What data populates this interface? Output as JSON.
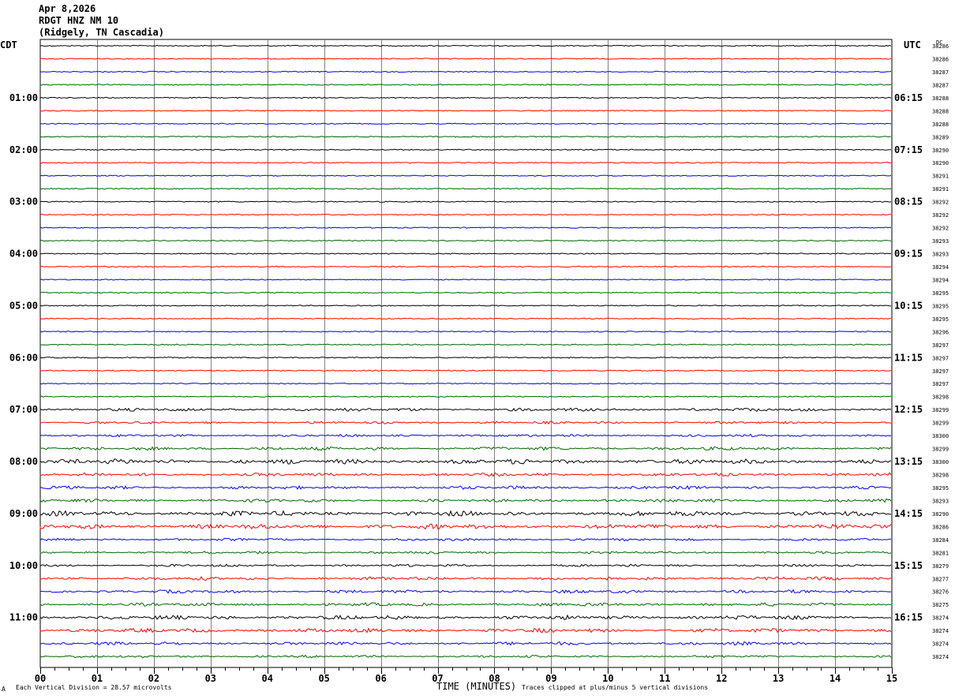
{
  "header": {
    "date": "Apr 8,2026",
    "station": "RDGT HNZ NM 10",
    "location": "(Ridgely, TN Cascadia)"
  },
  "left_tz": "CDT",
  "right_tz": "UTC",
  "dc_label": "DC",
  "footer": {
    "scale_note": "Each Vertical Division =   28.57 microvolts",
    "clip_note": "Traces clipped at plus/minus 5 vertical divisions",
    "corner_mark": "A"
  },
  "colors": {
    "trace_cycle": [
      "#000000",
      "#ff0000",
      "#0000ff",
      "#006400"
    ],
    "grid": "#808080"
  },
  "chart_data": {
    "type": "line",
    "title": "",
    "xlabel": "TIME (MINUTES)",
    "ylabel": "",
    "xlim": [
      0,
      15
    ],
    "x_ticks": [
      "00",
      "01",
      "02",
      "03",
      "04",
      "05",
      "06",
      "07",
      "08",
      "09",
      "10",
      "11",
      "12",
      "13",
      "14",
      "15"
    ],
    "left_time_labels": [
      "01:00",
      "02:00",
      "03:00",
      "04:00",
      "05:00",
      "06:00",
      "07:00",
      "08:00",
      "09:00",
      "10:00",
      "11:00"
    ],
    "right_time_labels": [
      "06:15",
      "07:15",
      "08:15",
      "09:15",
      "10:15",
      "11:15",
      "12:15",
      "13:15",
      "14:15",
      "15:15",
      "16:15"
    ],
    "dc_offsets": [
      38286,
      38286,
      38287,
      38287,
      38288,
      38288,
      38288,
      38289,
      38290,
      38290,
      38291,
      38291,
      38292,
      38292,
      38292,
      38293,
      38293,
      38294,
      38294,
      38295,
      38295,
      38295,
      38296,
      38297,
      38297,
      38297,
      38297,
      38298,
      38299,
      38299,
      38300,
      38299,
      38300,
      38298,
      38295,
      38293,
      38290,
      38286,
      38284,
      38281,
      38279,
      38277,
      38276,
      38275,
      38274,
      38274,
      38274,
      38274
    ],
    "trace_activity": [
      1,
      1,
      1,
      1,
      1,
      1,
      1,
      1,
      1,
      1,
      1,
      1,
      1,
      1,
      1,
      1,
      1,
      1,
      1,
      1,
      1,
      1,
      1,
      1,
      1,
      1,
      1,
      1,
      2,
      1.5,
      1.5,
      2,
      3,
      2,
      2,
      2,
      3,
      3,
      1.5,
      1.5,
      1.5,
      2,
      2,
      2,
      2.5,
      2.5,
      2,
      1.5
    ]
  }
}
